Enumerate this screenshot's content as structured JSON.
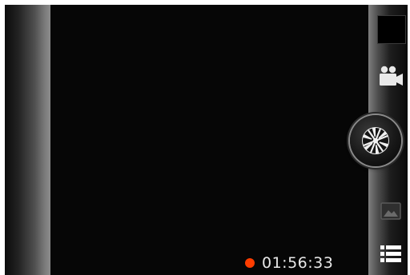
{
  "camera": {
    "recording": {
      "elapsed_time": "01:56:33",
      "indicator_color": "#ff3d00"
    },
    "controls": {
      "thumbnail": {
        "icon": "last-capture-thumbnail"
      },
      "video_mode": {
        "icon": "video-camera-icon"
      },
      "shutter": {
        "icon": "aperture-icon"
      },
      "gallery": {
        "icon": "gallery-icon"
      },
      "menu": {
        "icon": "menu-list-icon"
      }
    }
  }
}
